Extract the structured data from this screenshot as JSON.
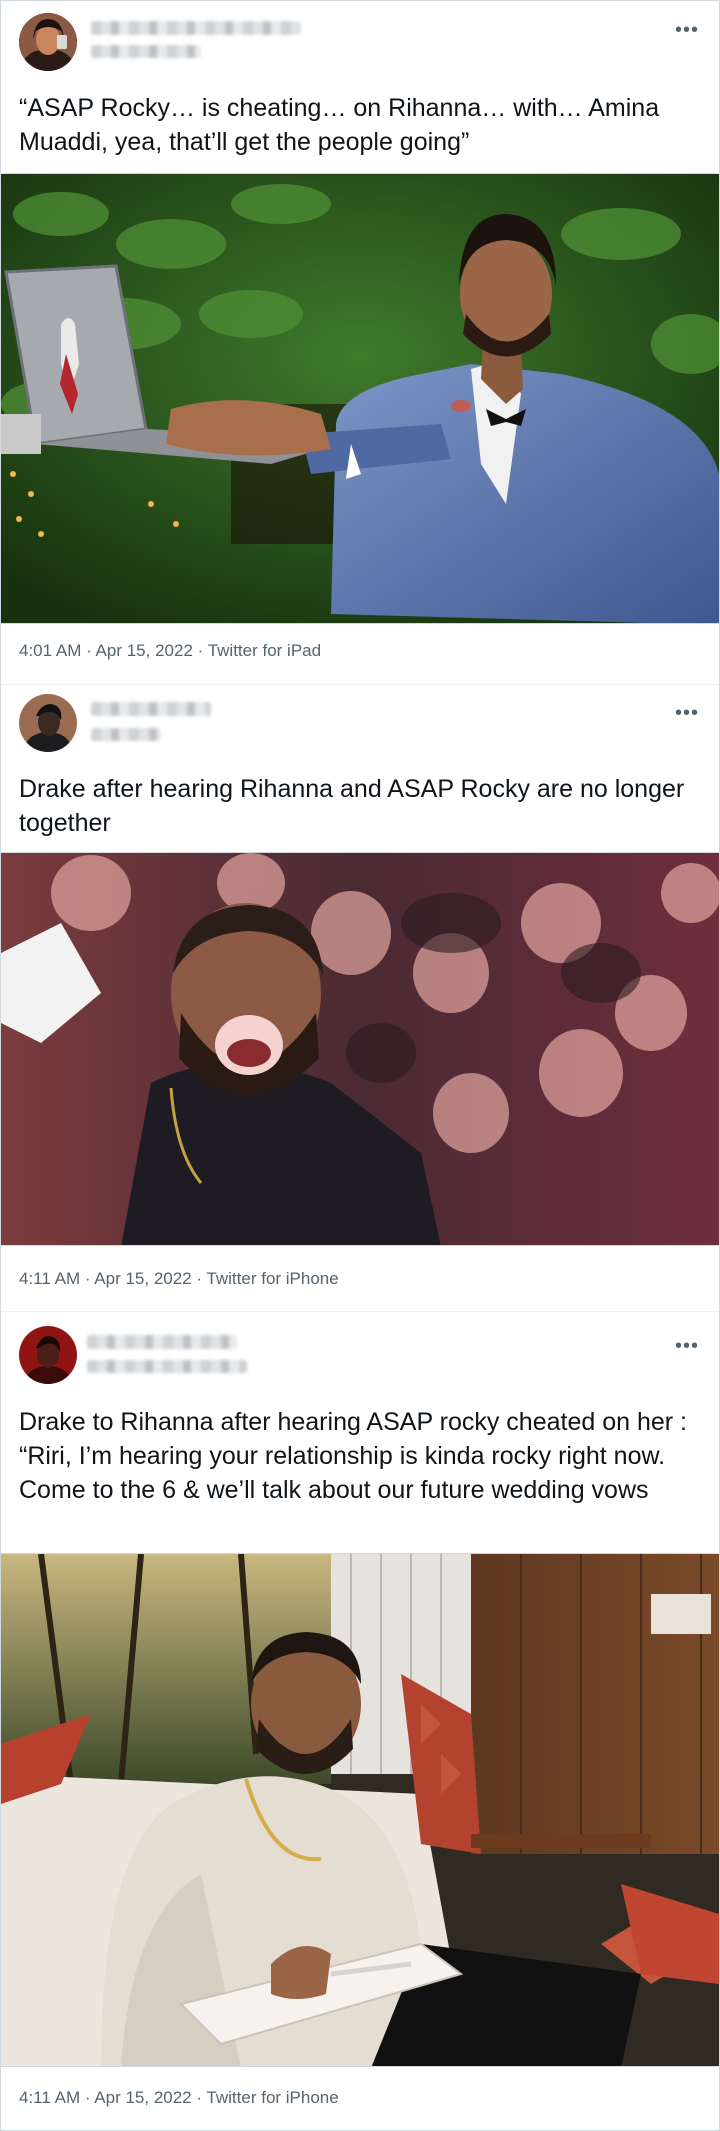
{
  "tweets": [
    {
      "more_icon": "more-horizontal-icon",
      "text": "“ASAP Rocky… is cheating… on Rihanna… with… Amina Muaddi, yea, that’ll get the people going”",
      "meta": "4:01 AM · Apr 15, 2022 · Twitter for iPad"
    },
    {
      "more_icon": "more-horizontal-icon",
      "text": "Drake after hearing Rihanna and ASAP Rocky are no longer together",
      "meta": "4:11 AM · Apr 15, 2022 · Twitter for iPhone"
    },
    {
      "more_icon": "more-horizontal-icon",
      "text": "Drake to Rihanna after hearing ASAP rocky cheated on her : “Riri, I’m hearing your relationship is kinda rocky right now. Come to the 6 & we’ll talk about our future wedding vows",
      "meta": "4:11 AM · Apr 15, 2022 · Twitter for iPhone"
    }
  ],
  "colors": {
    "text": "#0f1419",
    "secondary": "#536471",
    "border": "#cfd9de"
  }
}
